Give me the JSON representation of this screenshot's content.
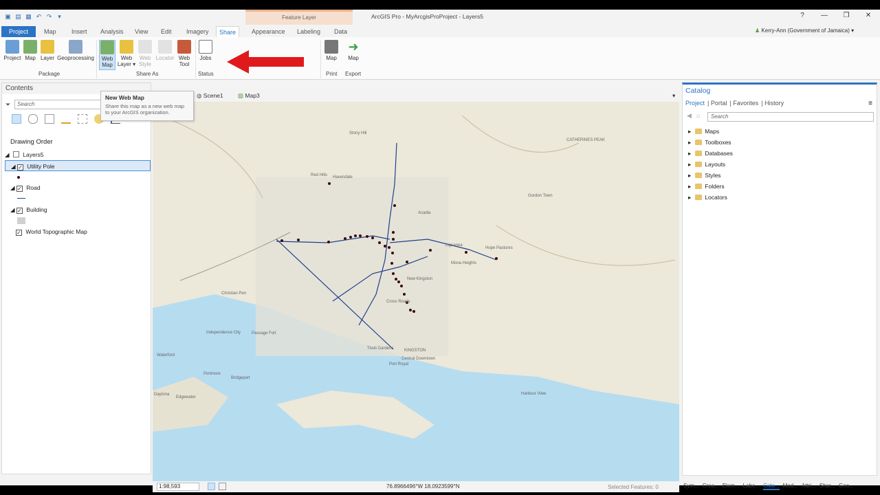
{
  "window": {
    "title": "ArcGIS Pro - MyArcgisProProject - Layers5",
    "context_tab_group": "Feature Layer",
    "user": "Kerry-Ann (Government of Jamaica)"
  },
  "tabs": [
    "Project",
    "Map",
    "Insert",
    "Analysis",
    "View",
    "Edit",
    "Imagery",
    "Share",
    "Appearance",
    "Labeling",
    "Data"
  ],
  "active_tab": "Share",
  "ribbon": {
    "package": {
      "label": "Package",
      "buttons": [
        "Project",
        "Map",
        "Layer",
        "Geoprocessing"
      ]
    },
    "share_as": {
      "label": "Share As",
      "buttons": [
        "Web Map",
        "Web Layer",
        "Web Style",
        "Locator",
        "Web Tool"
      ]
    },
    "status": {
      "label": "Status",
      "buttons": [
        "Jobs"
      ]
    },
    "print": {
      "label": "Print",
      "buttons": [
        "Map"
      ]
    },
    "export": {
      "label": "Export",
      "buttons": [
        "Map"
      ]
    }
  },
  "tooltip": {
    "title": "New Web Map",
    "body": "Share this map as a new web map to your ArcGIS organization."
  },
  "contents": {
    "title": "Contents",
    "search_placeholder": "Search",
    "drawing_order": "Drawing Order",
    "layers": [
      {
        "name": "Layers5",
        "level": 0
      },
      {
        "name": "Utility Pole",
        "level": 1,
        "checked": true,
        "selected": true
      },
      {
        "name": "Road",
        "level": 1,
        "checked": true
      },
      {
        "name": "Building",
        "level": 1,
        "checked": true
      },
      {
        "name": "World Topographic Map",
        "level": 1,
        "checked": true
      }
    ]
  },
  "view_tabs": [
    "Scene1",
    "Map3"
  ],
  "map": {
    "place_labels": [
      "Stony Hill",
      "Red Hills",
      "Havendale",
      "Acadia",
      "Liguanea",
      "Hope Pastures",
      "Mona Heights",
      "New Kingston",
      "Cross Roads",
      "KINGSTON",
      "Central Downtown",
      "Portmore",
      "Waterford",
      "Passage Fort",
      "Christian Pen",
      "Independence City",
      "Bridgeport",
      "Harbour View",
      "CATHERINES PEAK",
      "Gordon Town",
      "Daytona",
      "Edgewater",
      "Port Royal",
      "Tivoli Gardens"
    ],
    "accent_roads": "#1f3f8c",
    "pole_color": "#3a0a0a",
    "water_color": "#b6dcf0"
  },
  "status_bar": {
    "scale": "1:98,593",
    "coordinates": "76.8966496°W 18.0923599°N",
    "selected_features": "Selected Features: 0"
  },
  "catalog": {
    "title": "Catalog",
    "tabs": [
      "Project",
      "Portal",
      "Favorites",
      "History"
    ],
    "active_tab": "Project",
    "search_placeholder": "Search",
    "items": [
      "Maps",
      "Toolboxes",
      "Databases",
      "Layouts",
      "Styles",
      "Folders",
      "Locators"
    ]
  },
  "bottom_tabs": [
    "Sym...",
    "Crea...",
    "Elem...",
    "Labe...",
    "Cata...",
    "Mod...",
    "Attri...",
    "Shar...",
    "Geo..."
  ],
  "bottom_active": "Cata..."
}
